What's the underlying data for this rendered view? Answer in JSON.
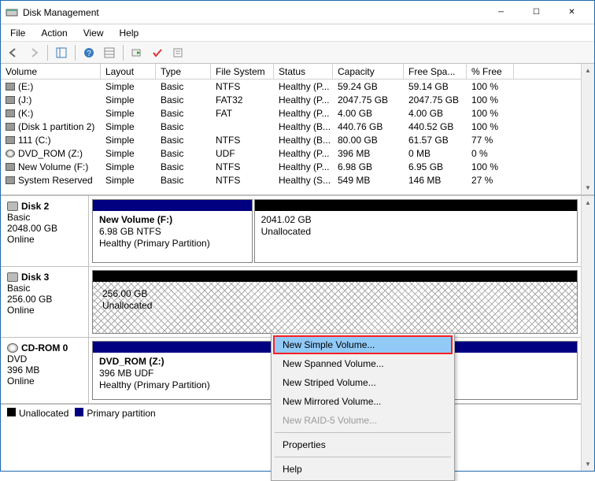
{
  "window": {
    "title": "Disk Management"
  },
  "menu": {
    "file": "File",
    "action": "Action",
    "view": "View",
    "help": "Help"
  },
  "columns": {
    "volume": "Volume",
    "layout": "Layout",
    "type": "Type",
    "filesystem": "File System",
    "status": "Status",
    "capacity": "Capacity",
    "free": "Free Spa...",
    "pct": "% Free"
  },
  "volumes": [
    {
      "name": "(E:)",
      "layout": "Simple",
      "type": "Basic",
      "fs": "NTFS",
      "status": "Healthy (P...",
      "cap": "59.24 GB",
      "free": "59.14 GB",
      "pct": "100 %",
      "icon": "hdd"
    },
    {
      "name": "(J:)",
      "layout": "Simple",
      "type": "Basic",
      "fs": "FAT32",
      "status": "Healthy (P...",
      "cap": "2047.75 GB",
      "free": "2047.75 GB",
      "pct": "100 %",
      "icon": "hdd"
    },
    {
      "name": "(K:)",
      "layout": "Simple",
      "type": "Basic",
      "fs": "FAT",
      "status": "Healthy (P...",
      "cap": "4.00 GB",
      "free": "4.00 GB",
      "pct": "100 %",
      "icon": "hdd"
    },
    {
      "name": "(Disk 1 partition 2)",
      "layout": "Simple",
      "type": "Basic",
      "fs": "",
      "status": "Healthy (B...",
      "cap": "440.76 GB",
      "free": "440.52 GB",
      "pct": "100 %",
      "icon": "hdd"
    },
    {
      "name": "111 (C:)",
      "layout": "Simple",
      "type": "Basic",
      "fs": "NTFS",
      "status": "Healthy (B...",
      "cap": "80.00 GB",
      "free": "61.57 GB",
      "pct": "77 %",
      "icon": "hdd"
    },
    {
      "name": "DVD_ROM (Z:)",
      "layout": "Simple",
      "type": "Basic",
      "fs": "UDF",
      "status": "Healthy (P...",
      "cap": "396 MB",
      "free": "0 MB",
      "pct": "0 %",
      "icon": "dvd"
    },
    {
      "name": "New Volume (F:)",
      "layout": "Simple",
      "type": "Basic",
      "fs": "NTFS",
      "status": "Healthy (P...",
      "cap": "6.98 GB",
      "free": "6.95 GB",
      "pct": "100 %",
      "icon": "hdd"
    },
    {
      "name": "System Reserved",
      "layout": "Simple",
      "type": "Basic",
      "fs": "NTFS",
      "status": "Healthy (S...",
      "cap": "549 MB",
      "free": "146 MB",
      "pct": "27 %",
      "icon": "hdd"
    }
  ],
  "disks": {
    "disk2": {
      "title": "Disk 2",
      "kind": "Basic",
      "size": "2048.00 GB",
      "state": "Online",
      "parts": [
        {
          "name": "New Volume  (F:)",
          "line2": "6.98 GB NTFS",
          "line3": "Healthy (Primary Partition)",
          "cls": "primary",
          "flex": 33
        },
        {
          "name": "",
          "line2": "2041.02 GB",
          "line3": "Unallocated",
          "cls": "",
          "flex": 67
        }
      ]
    },
    "disk3": {
      "title": "Disk 3",
      "kind": "Basic",
      "size": "256.00 GB",
      "state": "Online",
      "unalloc": {
        "size": "256.00 GB",
        "label": "Unallocated"
      }
    },
    "cdrom0": {
      "title": "CD-ROM 0",
      "kind": "DVD",
      "size": "396 MB",
      "state": "Online",
      "part": {
        "name": "DVD_ROM  (Z:)",
        "line2": "396 MB UDF",
        "line3": "Healthy (Primary Partition)"
      }
    }
  },
  "legend": {
    "unalloc": "Unallocated",
    "primary": "Primary partition"
  },
  "context": {
    "simple": "New Simple Volume...",
    "spanned": "New Spanned Volume...",
    "striped": "New Striped Volume...",
    "mirrored": "New Mirrored Volume...",
    "raid5": "New RAID-5 Volume...",
    "props": "Properties",
    "help": "Help"
  },
  "colors": {
    "primary_cap": "#000080",
    "unalloc_cap": "#000000"
  }
}
